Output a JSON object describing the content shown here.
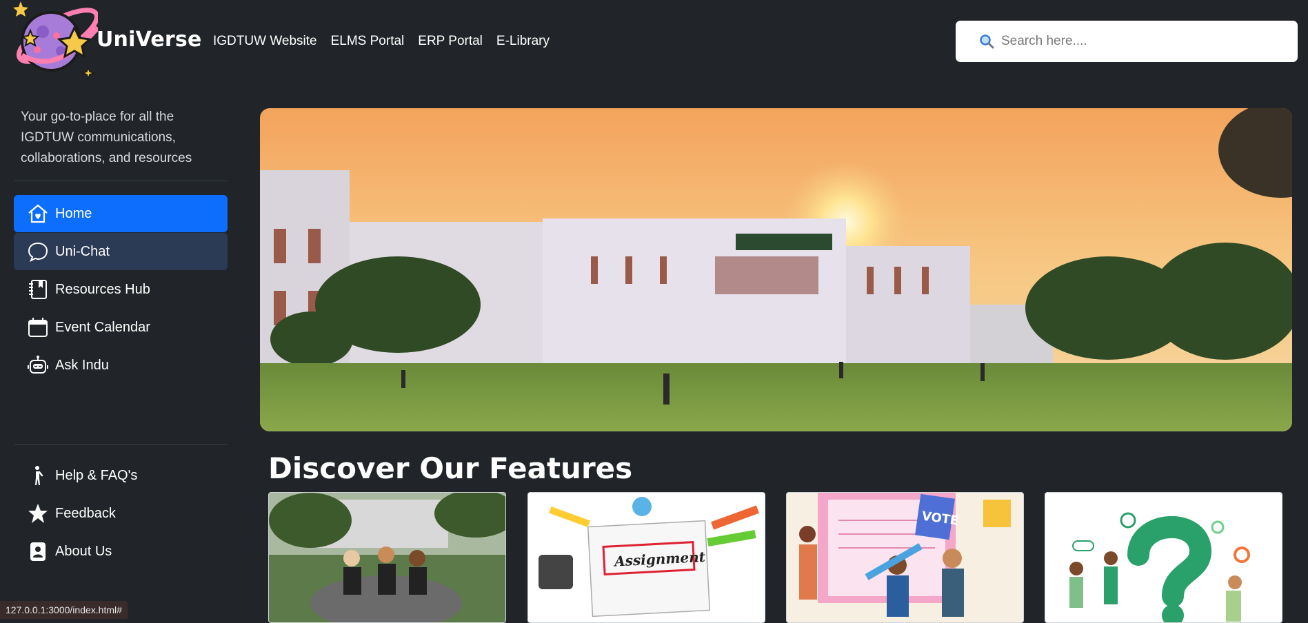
{
  "brand": {
    "name": "UniVerse"
  },
  "nav": {
    "links": [
      "IGDTUW Website",
      "ELMS Portal",
      "ERP Portal",
      "E-Library"
    ]
  },
  "search": {
    "placeholder": "Search here...."
  },
  "sidebar": {
    "tagline": "Your go-to-place for all the IGDTUW communications, collaborations, and resources",
    "items": [
      {
        "label": "Home",
        "icon": "home-icon"
      },
      {
        "label": "Uni-Chat",
        "icon": "chat-icon"
      },
      {
        "label": "Resources Hub",
        "icon": "notebook-icon"
      },
      {
        "label": "Event Calendar",
        "icon": "calendar-icon"
      },
      {
        "label": "Ask Indu",
        "icon": "robot-icon"
      }
    ],
    "bottom_items": [
      {
        "label": "Help & FAQ's",
        "icon": "person-icon"
      },
      {
        "label": "Feedback",
        "icon": "star-icon"
      },
      {
        "label": "About Us",
        "icon": "profile-icon"
      }
    ]
  },
  "main": {
    "section_title": "Discover Our Features",
    "cards": [
      {
        "image": "students-photo"
      },
      {
        "image": "assignment-illustration"
      },
      {
        "image": "voting-illustration"
      },
      {
        "image": "question-illustration"
      }
    ]
  },
  "statusbar": {
    "url": "127.0.0.1:3000/index.html#"
  },
  "colors": {
    "background": "#212529",
    "active": "#0d6efd",
    "hover": "#2b3a55"
  }
}
